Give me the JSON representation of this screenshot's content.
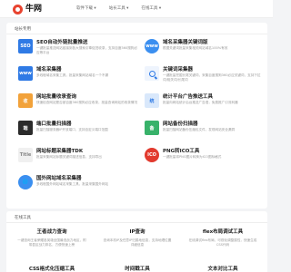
{
  "header": {
    "logo_text": "牛网",
    "nav": [
      "软件下载 ▾",
      "站长工具 ▾",
      "在线工具 ▾"
    ]
  },
  "seo_section": {
    "title": "站长专用",
    "tools": [
      {
        "name": "SEO自动外链批量推送",
        "desc": "一键批量推送网站链接到各大搜索引擎促进收录，支持百度360搜狗必应等平台",
        "icon": "seo-push-icon",
        "icon_text": "SEO"
      },
      {
        "name": "域名采集器关键词版",
        "desc": "根据关键词批量采集相关网站域名100%有效",
        "icon": "globe-icon",
        "icon_text": "www"
      },
      {
        "name": "域名采集器",
        "desc": "多线程域名采集工具，批量采集网站域名一个不漏",
        "icon": "domain-collector-icon",
        "icon_text": "www"
      },
      {
        "name": "关键词采集器",
        "desc": "一键批量挖掘长尾关键词，采集百度搜狗360必应关键词，支持下拉词/相关词/长尾词",
        "icon": "search-icon",
        "icon_text": ""
      },
      {
        "name": "网站批量收录查询",
        "desc": "快速检查网站是否被百度360搜狗必应收录，批量查询网站的收录情况",
        "icon": "index-check-icon",
        "icon_text": "收"
      },
      {
        "name": "统计平台广告推送工具",
        "desc": "批量向网站统计后台推送广告语，免费推广引流利器",
        "icon": "stats-push-icon",
        "icon_text": "统"
      },
      {
        "name": "端口批量扫描器",
        "desc": "批量扫描服务器IP开放端口，支持自定义端口范围",
        "icon": "port-scan-icon",
        "icon_text": "端"
      },
      {
        "name": "网站备份扫描器",
        "desc": "批量扫描网站备份压缩包文件，发现网站安全漏洞",
        "icon": "backup-scan-icon",
        "icon_text": "备"
      },
      {
        "name": "网站标题采集器TDK",
        "desc": "批量采集网站标题关键词描述信息，支持导出",
        "icon": "title-tdk-icon",
        "icon_text": "Title"
      },
      {
        "name": "PNG转ICO工具",
        "desc": "一键批量将PNG图片转换为ICO图标格式",
        "icon": "ico-convert-icon",
        "icon_text": "ICO"
      },
      {
        "name": "国外网站域名采集器",
        "desc": "多线程国外网站域名采集工具，批量采集国外网站",
        "icon": "foreign-domain-icon",
        "icon_text": "🌐"
      }
    ]
  },
  "util_section": {
    "title": "在线工具",
    "tools": [
      {
        "name": "王者战力查询",
        "desc": "一键查询王者荣耀各英雄全国最低战力地区，附带县区战力排名，方便快速上榜"
      },
      {
        "name": "IP查询",
        "desc": "查询本机IP及任意IP归属地信息，支持地理位置详细信息"
      },
      {
        "name": "flex布局调试工具",
        "desc": "在线调试flex布局，可视化调整属性，快速生成CSS代码"
      }
    ],
    "row2": [
      "CSS格式化压缩工具",
      "时间戳工具",
      "文本对比工具"
    ]
  }
}
